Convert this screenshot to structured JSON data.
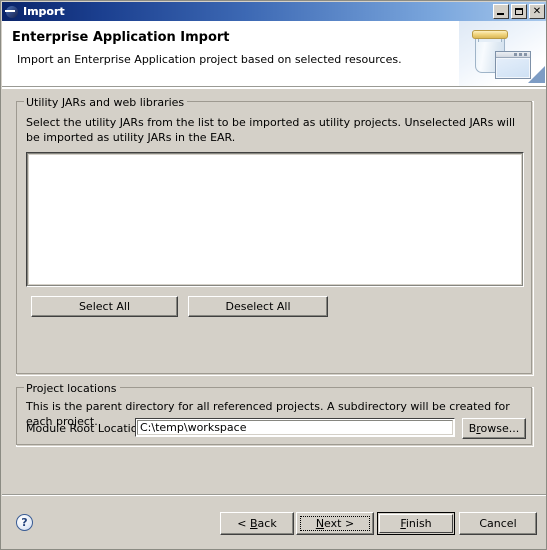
{
  "window": {
    "title": "Import",
    "icon": "eclipse-import-icon",
    "controls": {
      "minimize": "Minimize",
      "maximize": "Maximize",
      "close": "Close"
    }
  },
  "banner": {
    "title": "Enterprise Application Import",
    "description": "Import an Enterprise Application project based on selected resources.",
    "graphic": "jar-and-window-icon"
  },
  "utility_group": {
    "label": "Utility JARs and web libraries",
    "description": "Select the utility JARs from the list to be imported as utility projects. Unselected JARs will be imported as utility JARs in the EAR.",
    "list_items": [],
    "select_all_label": "Select All",
    "deselect_all_label": "Deselect All"
  },
  "project_locations_group": {
    "label": "Project locations",
    "description": "This is the parent directory for all referenced projects. A subdirectory will be created for each project.",
    "module_root_label": "Module Root Location:",
    "module_root_value": "C:\\temp\\workspace",
    "module_root_placeholder": "",
    "browse_label_pre": "B",
    "browse_label_mnemonic": "r",
    "browse_label_post": "owse..."
  },
  "footer": {
    "help_glyph": "?",
    "back_pre": "< ",
    "back_mnemonic": "B",
    "back_post": "ack",
    "next_pre": "",
    "next_mnemonic": "N",
    "next_post": "ext >",
    "finish_mnemonic": "F",
    "finish_post": "inish",
    "cancel_label": "Cancel"
  },
  "colors": {
    "dialog_background": "#d4d0c8",
    "titlebar_start": "#0a246a",
    "titlebar_end": "#a8c8ec",
    "banner_background": "#ffffff",
    "field_background": "#ffffff",
    "text": "#000000",
    "help_icon": "#26457e"
  }
}
